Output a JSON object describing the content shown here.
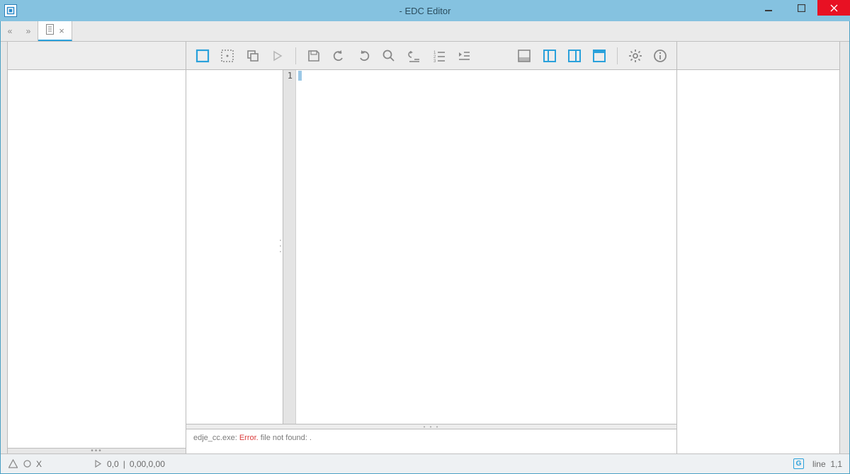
{
  "window": {
    "title": "- EDC Editor"
  },
  "tabs": {
    "nav_back": "«",
    "nav_fwd": "»"
  },
  "editor": {
    "line_numbers": [
      "1"
    ]
  },
  "console": {
    "source": "edje_cc.exe:",
    "level": "Error.",
    "message": "file not found: ."
  },
  "status": {
    "error_count": "X",
    "play_label": "0,0",
    "sep": "|",
    "coords": "0,00,0,00",
    "mode_badge": "G",
    "line_label": "line",
    "line_pos": "1,1"
  },
  "icons": {
    "toolbar": [
      "square",
      "dashed-square",
      "copy",
      "play",
      "save",
      "undo",
      "redo",
      "search",
      "indent-left",
      "line-numbers",
      "indent-right"
    ],
    "layout": [
      "layout-bottom",
      "layout-left",
      "layout-right",
      "layout-full"
    ],
    "meta": [
      "gear",
      "info"
    ]
  }
}
